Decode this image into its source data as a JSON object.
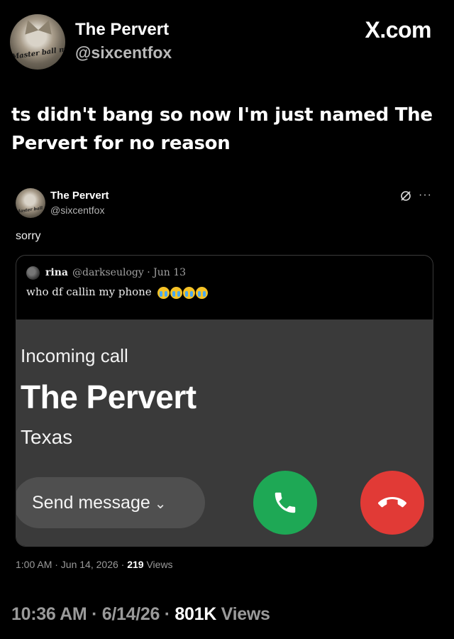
{
  "header": {
    "name": "The Pervert",
    "handle": "@sixcentfox",
    "avatar_caption": "Master ball me",
    "site": "X.com"
  },
  "tweet": {
    "text": "ts didn't bang so now I'm just named The Pervert for no reason"
  },
  "embedded_post": {
    "name": "The Pervert",
    "handle": "@sixcentfox",
    "avatar_caption": "Master ball me",
    "text": "sorry",
    "icons": [
      "grok-icon",
      "more-icon"
    ],
    "more_label": "···",
    "quote": {
      "name": "rina",
      "meta": "@darkseulogy · Jun 13",
      "text": "who df callin my phone",
      "emoji_count": 4,
      "call_screen": {
        "label": "Incoming call",
        "caller": "The Pervert",
        "location": "Texas",
        "send_message": "Send message",
        "accept_icon": "phone-accept-icon",
        "decline_icon": "phone-decline-icon",
        "accept_color": "#1ea855",
        "decline_color": "#e13a36"
      }
    },
    "timestamp": "1:00 AM · Jun 14, 2026 ·",
    "views_count": "219",
    "views_label": "Views"
  },
  "footer": {
    "timestamp": "10:36 AM · 6/14/26 ·",
    "views_count": "801K",
    "views_label": "Views"
  }
}
